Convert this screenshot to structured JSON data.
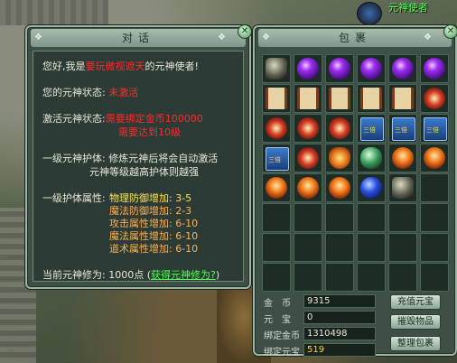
{
  "npc_name": "元神使者",
  "dialog": {
    "title": "对话",
    "greeting_pre": "您好,我是",
    "greeting_highlight": "要玩微视遮天",
    "greeting_post": "的元神使者!",
    "status_label": "您的元神状态:",
    "status_value": "未激活",
    "activate_label": "激活元神状态:",
    "activate_req1": "需要绑定金币100000",
    "activate_req2": "需要达到10级",
    "protect_label": "一级元神护体:",
    "protect_desc1": "修炼元神后将会自动激活",
    "protect_desc2": "元神等级越高护体则越强",
    "attr_label": "一级护体属性:",
    "attrs": [
      "物理防御增加: 3-5",
      "魔法防御增加: 2-3",
      "攻击属性增加: 6-10",
      "魔法属性增加: 6-10",
      "道术属性增加: 6-10"
    ],
    "cultivation_label": "当前元神修为: 1000点",
    "cultivation_open": "(",
    "cultivation_link": "获得元神修为?",
    "cultivation_close": ")"
  },
  "bag": {
    "title": "包裹",
    "items": [
      "stone-icon",
      "purple-orb-icon",
      "purple-orb-icon",
      "purple-orb-icon",
      "purple-orb-icon",
      "purple-orb-icon",
      "scroll-icon",
      "scroll-icon",
      "scroll-icon",
      "scroll-icon",
      "scroll-icon",
      "charm-icon",
      "charm-icon",
      "charm-icon",
      "charm-icon",
      "book-icon",
      "book-icon",
      "book-icon",
      "book-icon",
      "charm-icon",
      "heart-icon",
      "jade-icon",
      "skull-icon",
      "skull-icon",
      "skull-icon",
      "skull-icon",
      "skull-icon",
      "gem-icon",
      "stone-icon",
      "",
      "",
      "",
      "",
      "",
      "",
      "",
      "",
      "",
      "",
      "",
      "",
      "",
      "",
      "",
      "",
      "",
      "",
      ""
    ],
    "book_text": "三倍",
    "gold_label": "金　币",
    "gold_value": "9315",
    "yuanbao_label": "元　宝",
    "yuanbao_value": "0",
    "bound_gold_label": "绑定金币",
    "bound_gold_value": "1310498",
    "bound_yuanbao_label": "绑定元宝",
    "bound_yuanbao_value": "519",
    "btn_recharge": "充值元宝",
    "btn_drop": "摧毁物品",
    "btn_sort": "整理包裹"
  }
}
